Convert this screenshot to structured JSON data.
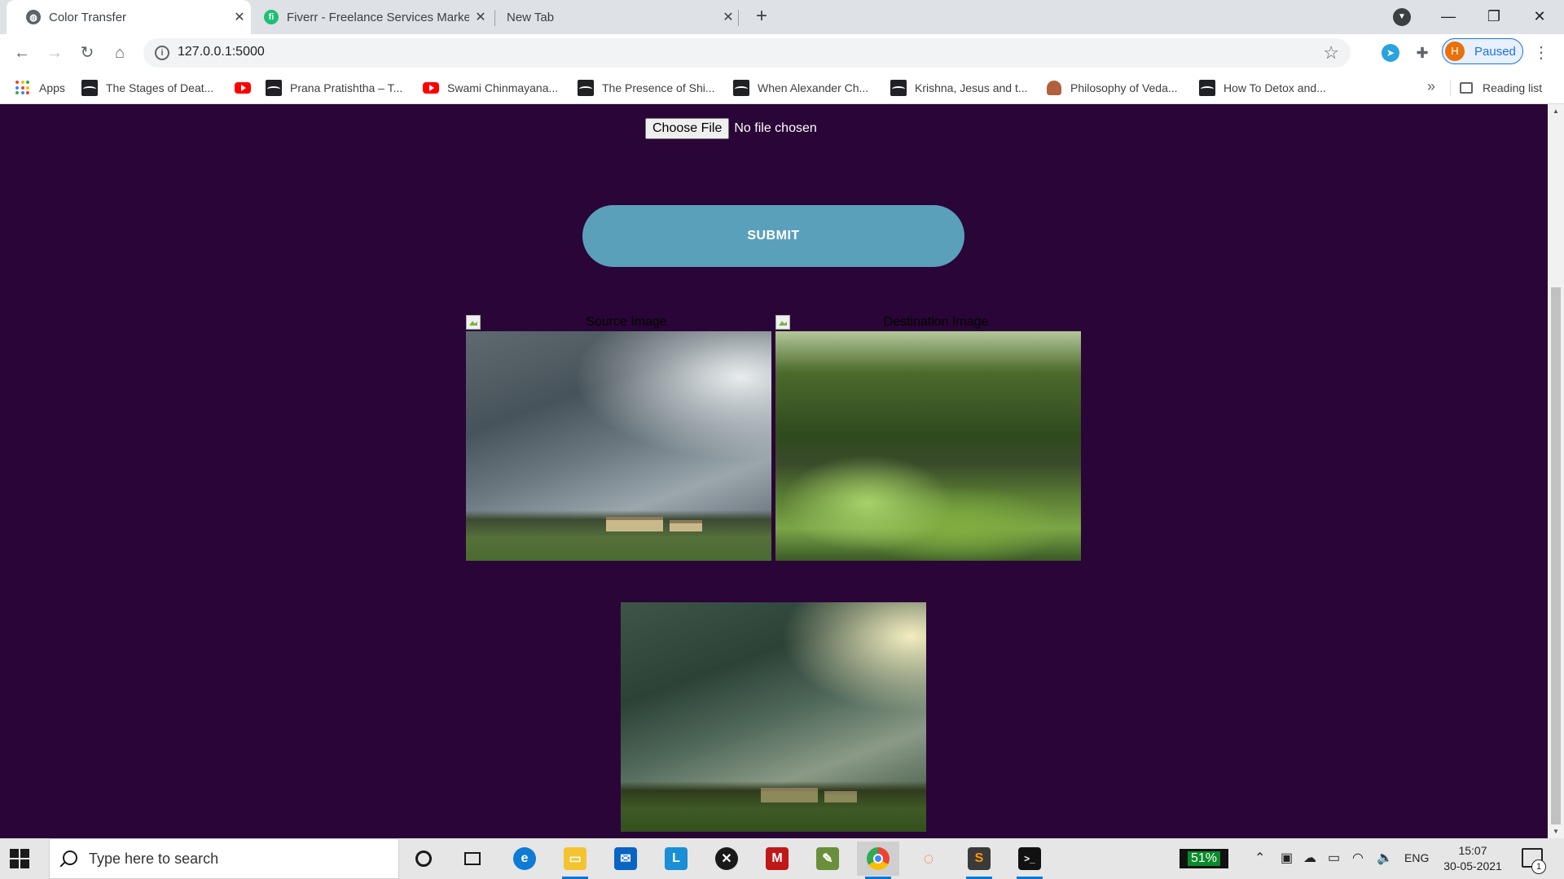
{
  "browser": {
    "tabs": [
      {
        "title": "Color Transfer",
        "active": true
      },
      {
        "title": "Fiverr - Freelance Services Marketplace",
        "active": false
      },
      {
        "title": "New Tab",
        "active": false
      }
    ],
    "new_tab_label": "+",
    "url": "127.0.0.1:5000",
    "profile_initial": "H",
    "profile_label": "Paused"
  },
  "bookmarks": {
    "apps_label": "Apps",
    "items": [
      {
        "label": "The Stages of Deat...",
        "icon": "dark-thumb-icon"
      },
      {
        "label": "",
        "icon": "youtube-icon"
      },
      {
        "label": "Prana Pratishtha – T...",
        "icon": "dark-thumb-icon"
      },
      {
        "label": "Swami Chinmayana...",
        "icon": "youtube-icon"
      },
      {
        "label": "The Presence of Shi...",
        "icon": "dark-thumb-icon"
      },
      {
        "label": "When Alexander Ch...",
        "icon": "dark-thumb-icon"
      },
      {
        "label": "Krishna, Jesus and t...",
        "icon": "dark-thumb-icon"
      },
      {
        "label": "Philosophy of Veda...",
        "icon": "monk-icon"
      },
      {
        "label": "How To Detox and...",
        "icon": "dark-thumb-icon"
      }
    ],
    "more_label": "»",
    "reading_list_label": "Reading list"
  },
  "page": {
    "choose_file_label": "Choose File",
    "no_file_text": "No file chosen",
    "submit_label": "SUBMIT",
    "source_alt": "Source Image",
    "destination_alt": "Destination Image",
    "background_color": "#2a0537",
    "submit_color": "#5ba0bb"
  },
  "taskbar": {
    "search_placeholder": "Type here to search",
    "battery": "51%",
    "language": "ENG",
    "time": "15:07",
    "date": "30-05-2021",
    "notification_count": "1"
  }
}
